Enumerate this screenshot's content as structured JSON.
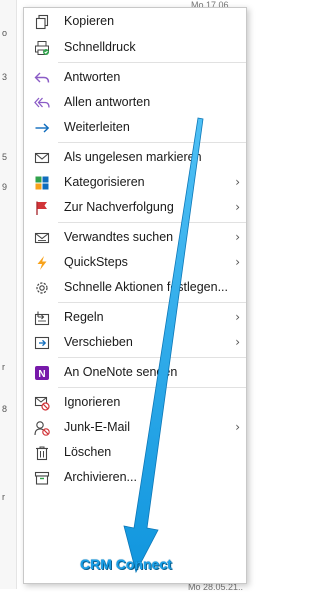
{
  "background": {
    "top_text": "Mo 17.06.",
    "bottom_text": "Mo 28.05.21..",
    "left_marks": [
      "o",
      "3",
      "5",
      "9",
      "r",
      "8",
      "r"
    ]
  },
  "menu": {
    "items": [
      {
        "id": "kopieren",
        "label": "Kopieren",
        "icon": "copy-icon",
        "submenu": false
      },
      {
        "id": "schnelldruck",
        "label": "Schnelldruck",
        "icon": "print-icon",
        "submenu": false
      },
      {
        "id": "antworten",
        "label": "Antworten",
        "icon": "reply-icon",
        "submenu": false
      },
      {
        "id": "allen-antworten",
        "label": "Allen antworten",
        "icon": "reply-all-icon",
        "submenu": false
      },
      {
        "id": "weiterleiten",
        "label": "Weiterleiten",
        "icon": "forward-icon",
        "submenu": false
      },
      {
        "id": "als-ungelesen",
        "label": "Als ungelesen markieren",
        "icon": "envelope-icon",
        "submenu": false
      },
      {
        "id": "kategorisieren",
        "label": "Kategorisieren",
        "icon": "categorize-icon",
        "submenu": true
      },
      {
        "id": "nachverfolgung",
        "label": "Zur Nachverfolgung",
        "icon": "flag-icon",
        "submenu": true
      },
      {
        "id": "verwandtes",
        "label": "Verwandtes suchen",
        "icon": "related-mail-icon",
        "submenu": true
      },
      {
        "id": "quicksteps",
        "label": "QuickSteps",
        "icon": "lightning-icon",
        "submenu": true
      },
      {
        "id": "schnelle-aktionen",
        "label": "Schnelle Aktionen festlegen...",
        "icon": "gear-icon",
        "submenu": false
      },
      {
        "id": "regeln",
        "label": "Regeln",
        "icon": "rules-icon",
        "submenu": true
      },
      {
        "id": "verschieben",
        "label": "Verschieben",
        "icon": "move-icon",
        "submenu": true
      },
      {
        "id": "onenote",
        "label": "An OneNote senden",
        "icon": "onenote-icon",
        "submenu": false
      },
      {
        "id": "ignorieren",
        "label": "Ignorieren",
        "icon": "ignore-icon",
        "submenu": false
      },
      {
        "id": "junk",
        "label": "Junk-E-Mail",
        "icon": "junk-icon",
        "submenu": true
      },
      {
        "id": "loeschen",
        "label": "Löschen",
        "icon": "trash-icon",
        "submenu": false
      },
      {
        "id": "archivieren",
        "label": "Archivieren...",
        "icon": "archive-icon",
        "submenu": false
      }
    ]
  },
  "overlay": {
    "label": "CRM Connect",
    "color": "#1aa0e8"
  },
  "colors": {
    "accent_blue": "#0f6cbd",
    "reply_purple": "#8b5cc6",
    "flag_red": "#d13438",
    "onenote_purple": "#7719aa",
    "quicksteps_orange": "#f7a21b"
  }
}
